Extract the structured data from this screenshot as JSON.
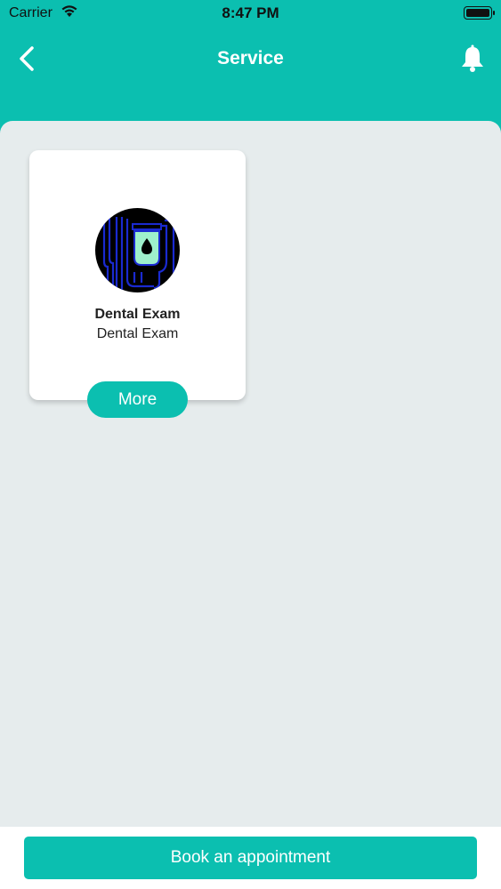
{
  "status_bar": {
    "carrier": "Carrier",
    "time": "8:47 PM"
  },
  "header": {
    "title": "Service",
    "back_icon": "chevron-left-icon",
    "notification_icon": "bell-icon"
  },
  "services": [
    {
      "name": "Dental Exam",
      "subtitle": "Dental Exam",
      "icon": "iv-drip-icon",
      "more_label": "More"
    }
  ],
  "footer": {
    "book_label": "Book an appointment"
  },
  "colors": {
    "accent": "#0bbfb0",
    "background": "#e6eced",
    "card": "#ffffff"
  }
}
